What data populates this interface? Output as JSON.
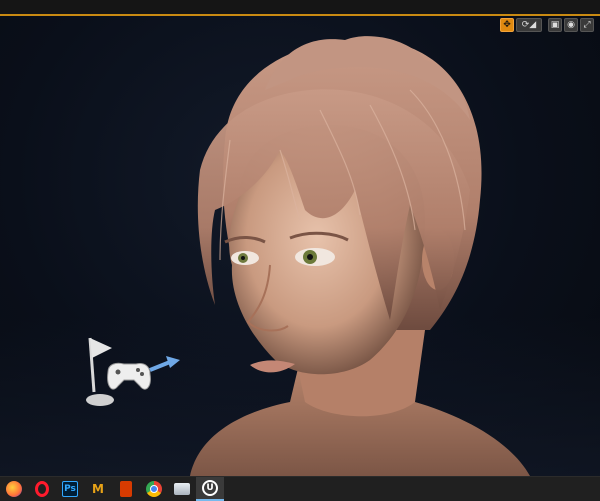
{
  "viewport_toolbar": {
    "buttons": [
      {
        "icon": "transform-gizmo-icon",
        "active": true
      },
      {
        "icon": "rotate-snap-icon",
        "active": false
      },
      {
        "icon": "scale-snap-icon",
        "active": false
      },
      {
        "icon": "camera-speed-icon",
        "active": false
      },
      {
        "icon": "maximize-viewport-icon",
        "active": false
      }
    ]
  },
  "scene": {
    "actor": "player-start-icon",
    "subject": "character-portrait"
  },
  "taskbar": {
    "apps": [
      {
        "name": "firefox",
        "icon": "firefox-icon",
        "color": "#ff7139"
      },
      {
        "name": "opera",
        "icon": "opera-icon",
        "color": "#ff1b2d"
      },
      {
        "name": "photoshop",
        "icon": "photoshop-icon",
        "label": "Ps",
        "color": "#31a8ff"
      },
      {
        "name": "maya",
        "icon": "maya-icon",
        "label": "M",
        "color": "#e8a317"
      },
      {
        "name": "office",
        "icon": "office-icon",
        "color": "#d83b01"
      },
      {
        "name": "chrome",
        "icon": "chrome-icon",
        "color": "#4285f4"
      },
      {
        "name": "explorer",
        "icon": "file-explorer-icon",
        "color": "#c9d1da"
      },
      {
        "name": "unreal-engine",
        "icon": "unreal-engine-icon",
        "active": true,
        "color": "#ffffff"
      }
    ]
  },
  "colors": {
    "accent": "#e08a10",
    "taskbar_active": "#76b9ed"
  }
}
